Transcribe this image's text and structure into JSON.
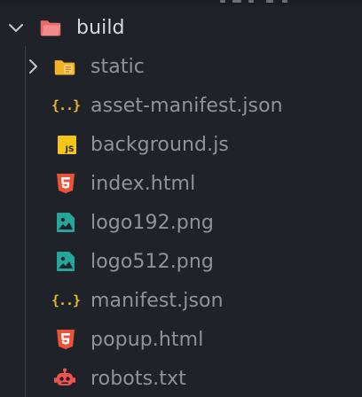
{
  "colors": {
    "background": "#1f2229",
    "text_root": "#d6d9de",
    "text_item": "#8e939c",
    "folder_root": "#e86a6a",
    "folder_static": "#f0b429",
    "js": "#f5c518",
    "json": "#e5b730",
    "html": "#e8543a",
    "image": "#26a69a",
    "robot": "#ef5350"
  },
  "root": {
    "label": "build",
    "expanded": true,
    "icon": "folder-open-icon"
  },
  "items": [
    {
      "label": "static",
      "icon": "folder-icon",
      "kind": "folder",
      "expanded": false
    },
    {
      "label": "asset-manifest.json",
      "icon": "json-icon",
      "kind": "file"
    },
    {
      "label": "background.js",
      "icon": "js-icon",
      "kind": "file"
    },
    {
      "label": "index.html",
      "icon": "html5-icon",
      "kind": "file"
    },
    {
      "label": "logo192.png",
      "icon": "image-icon",
      "kind": "file"
    },
    {
      "label": "logo512.png",
      "icon": "image-icon",
      "kind": "file"
    },
    {
      "label": "manifest.json",
      "icon": "json-icon",
      "kind": "file"
    },
    {
      "label": "popup.html",
      "icon": "html5-icon",
      "kind": "file"
    },
    {
      "label": "robots.txt",
      "icon": "robot-icon",
      "kind": "file"
    }
  ]
}
